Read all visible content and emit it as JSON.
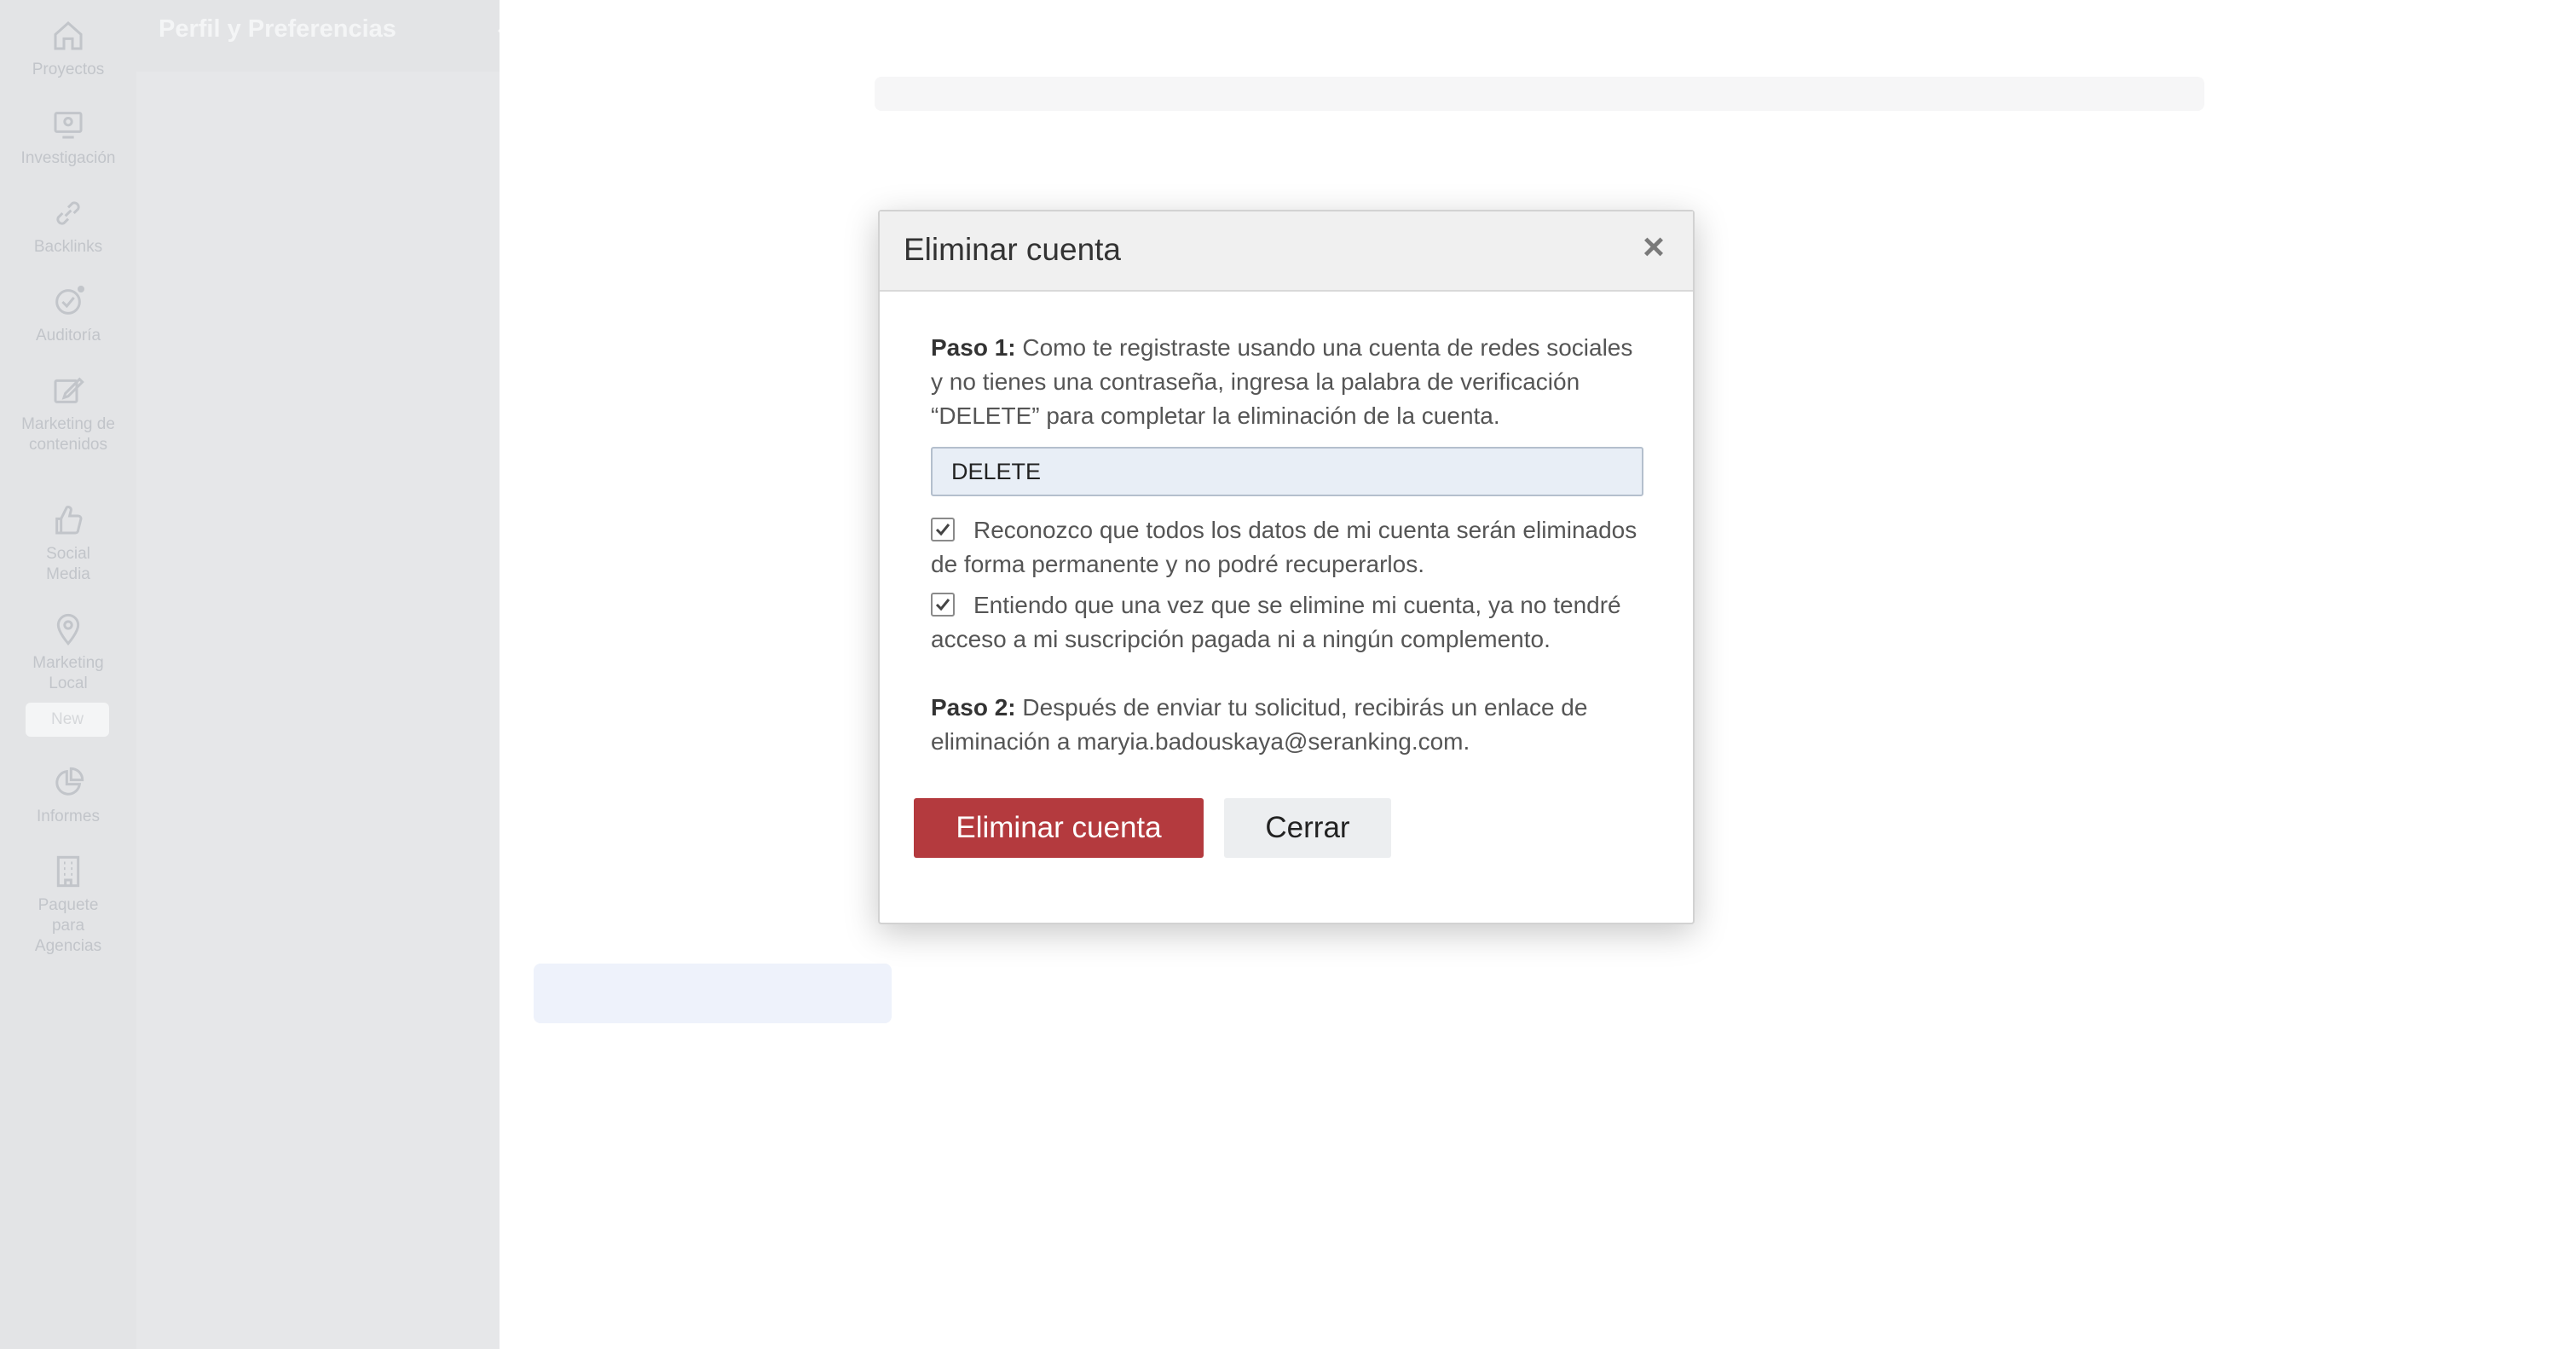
{
  "sidebar": {
    "items": [
      {
        "label": "Proyectos",
        "icon": "home-icon"
      },
      {
        "label": "Investigación",
        "icon": "monitor-icon"
      },
      {
        "label": "Backlinks",
        "icon": "link-icon"
      },
      {
        "label": "Auditoría",
        "icon": "check-circle-icon"
      },
      {
        "label": "Marketing de contenidos",
        "icon": "edit-icon"
      },
      {
        "label": "Social Media",
        "icon": "thumbs-up-icon"
      },
      {
        "label": "Marketing Local",
        "icon": "map-pin-icon"
      },
      {
        "label": "Informes",
        "icon": "pie-chart-icon"
      },
      {
        "label": "Paquete para Agencias",
        "icon": "building-icon"
      }
    ],
    "new_badge": "New"
  },
  "submenu": {
    "title": "Perfil y Preferencias",
    "collapse_icon": "chevron-left-icon"
  },
  "dialog": {
    "title": "Eliminar cuenta",
    "close_icon": "close-icon",
    "step1_label": "Paso 1:",
    "step1_text": " Como te registraste usando una cuenta de redes sociales y no tienes una contraseña, ingresa la palabra de verificación “DELETE” para completar la eliminación de la cuenta.",
    "verify_value": "DELETE",
    "check1_text": "Reconozco que todos los datos de mi cuenta serán eliminados de forma permanente y no podré recuperarlos.",
    "check1_checked": true,
    "check2_text": "Entiendo que una vez que se elimine mi cuenta, ya no tendré acceso a mi suscripción pagada ni a ningún complemento.",
    "check2_checked": true,
    "step2_label": "Paso 2:",
    "step2_text": " Después de enviar tu solicitud, recibirás un enlace de eliminación a maryia.badouskaya@seranking.com.",
    "delete_button": "Eliminar cuenta",
    "close_button": "Cerrar"
  },
  "colors": {
    "danger": "#b43a3e",
    "input_bg": "#e8eef6",
    "rail_bg": "#e3e4e6"
  }
}
